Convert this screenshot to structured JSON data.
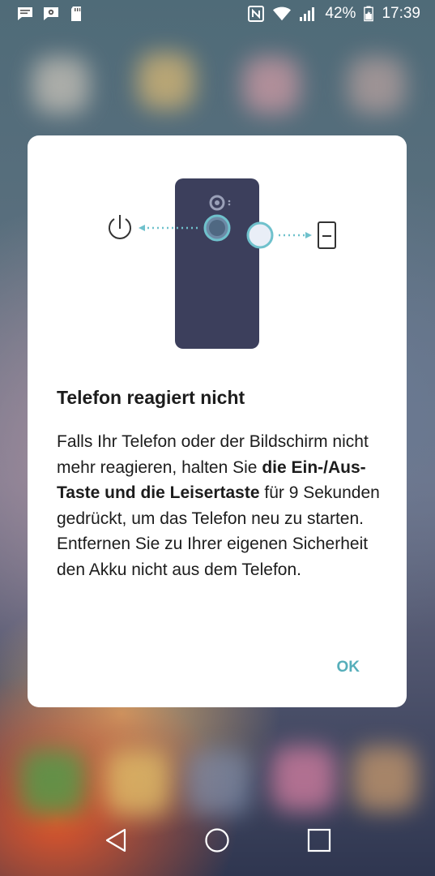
{
  "status_bar": {
    "battery_percent": "42%",
    "time": "17:39",
    "left_icons": [
      "message-icon",
      "settings-notification-icon",
      "sd-card-icon"
    ],
    "right_icons": [
      "nfc-icon",
      "wifi-icon",
      "signal-icon",
      "battery-icon"
    ]
  },
  "dialog": {
    "title": "Telefon reagiert nicht",
    "body_part1": "Falls Ihr Telefon oder der Bildschirm nicht mehr reagieren, halten Sie ",
    "body_bold": "die Ein-/Aus-Taste und die Leisertaste",
    "body_part2": " für 9 Sekunden gedrückt, um das Telefon neu zu starten.",
    "body_part3": "Entfernen Sie zu Ihrer eigenen Sicherheit den Akku nicht aus dem Telefon.",
    "ok_label": "OK",
    "illustration_icons": [
      "power-icon",
      "volume-down-icon"
    ]
  },
  "colors": {
    "accent": "#56aeba",
    "phone_body": "#3c3f5c",
    "dialog_bg": "#ffffff"
  },
  "nav_bar": {
    "icons": [
      "back-icon",
      "home-icon",
      "recents-icon"
    ]
  }
}
